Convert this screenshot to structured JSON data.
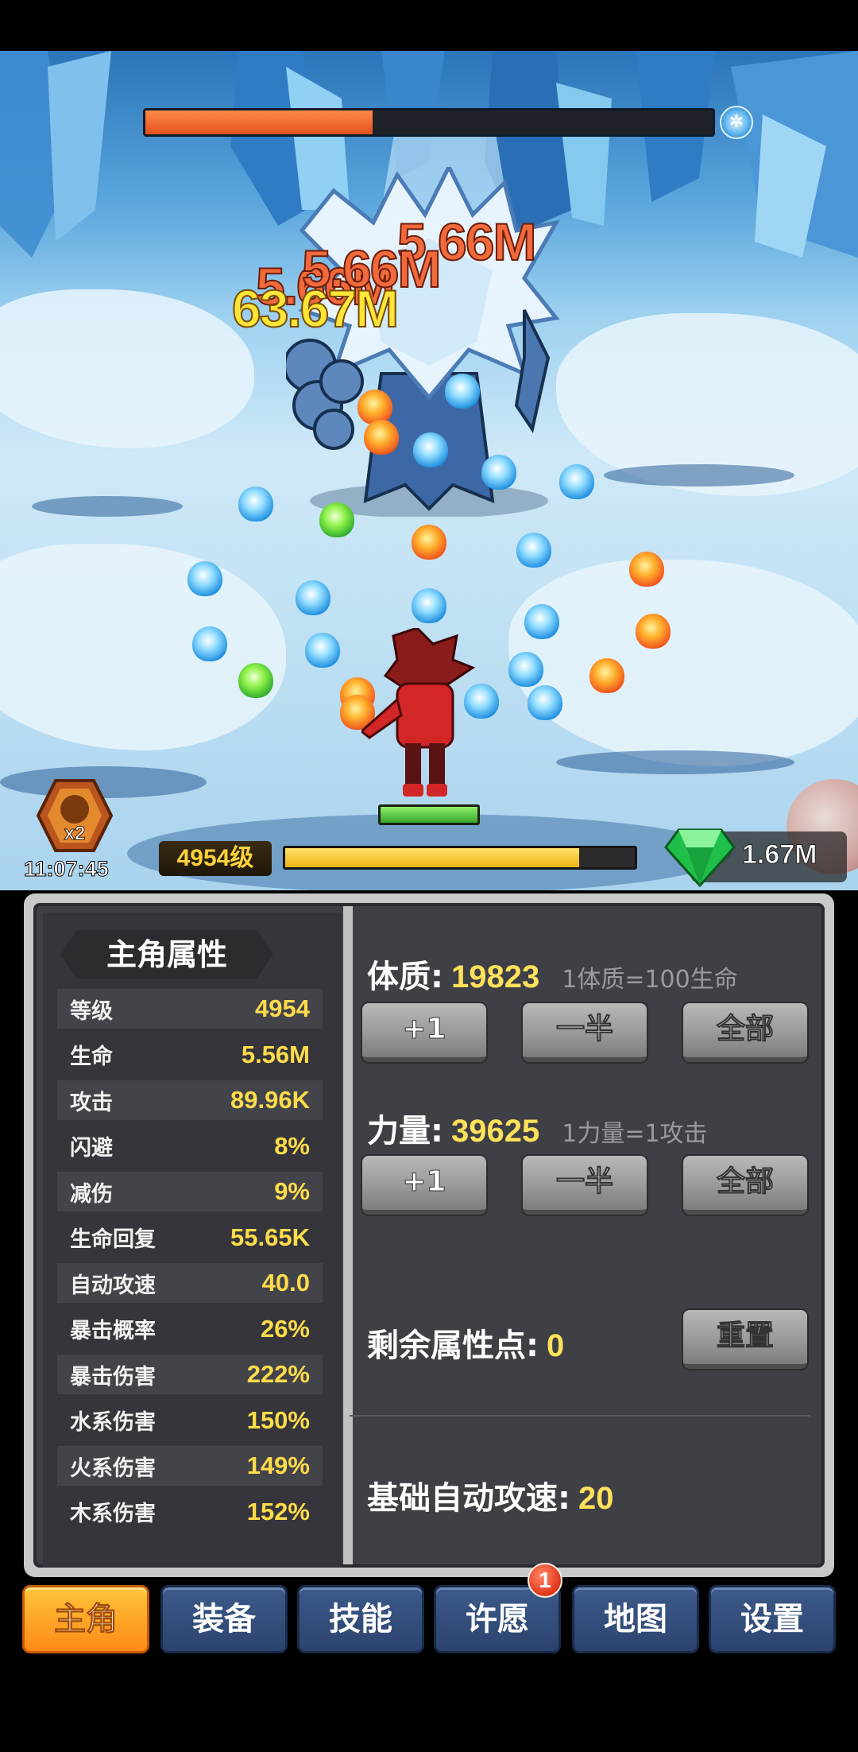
{
  "battle": {
    "boss_hp_fraction": 0.4,
    "damage_numbers": [
      "5.66M",
      "5.66M",
      "63.67M",
      "5.66M"
    ],
    "hero_hp_fraction": 1.0,
    "buff": {
      "label": "x2",
      "timer": "11:07:45"
    },
    "level": {
      "label": "4954级",
      "exp_fraction": 0.84
    },
    "gems": "1.67M"
  },
  "panel": {
    "title": "主角属性",
    "stats": [
      {
        "label": "等级",
        "value": "4954"
      },
      {
        "label": "生命",
        "value": "5.56M"
      },
      {
        "label": "攻击",
        "value": "89.96K"
      },
      {
        "label": "闪避",
        "value": "8%"
      },
      {
        "label": "减伤",
        "value": "9%"
      },
      {
        "label": "生命回复",
        "value": "55.65K"
      },
      {
        "label": "自动攻速",
        "value": "40.0"
      },
      {
        "label": "暴击概率",
        "value": "26%"
      },
      {
        "label": "暴击伤害",
        "value": "222%"
      },
      {
        "label": "水系伤害",
        "value": "150%"
      },
      {
        "label": "火系伤害",
        "value": "149%"
      },
      {
        "label": "木系伤害",
        "value": "152%"
      }
    ],
    "constitution": {
      "label": "体质:",
      "value": "19823",
      "note": "1体质=100生命"
    },
    "strength": {
      "label": "力量:",
      "value": "39625",
      "note": "1力量=1攻击"
    },
    "buttons": {
      "plus_one": "+1",
      "half": "一半",
      "all": "全部",
      "reset": "重置"
    },
    "remaining_points": {
      "label": "剩余属性点:",
      "value": "0"
    },
    "base_attack_speed": {
      "label": "基础自动攻速:",
      "value": "20"
    }
  },
  "tabs": [
    "主角",
    "装备",
    "技能",
    "许愿",
    "地图",
    "设置"
  ],
  "wish_badge": "1",
  "colors": {
    "accent_yellow": "#ffdc4a",
    "tab_active": "#ff9a1e",
    "tab_inactive": "#2f4a78",
    "panel_bg": "#3f3f46"
  }
}
